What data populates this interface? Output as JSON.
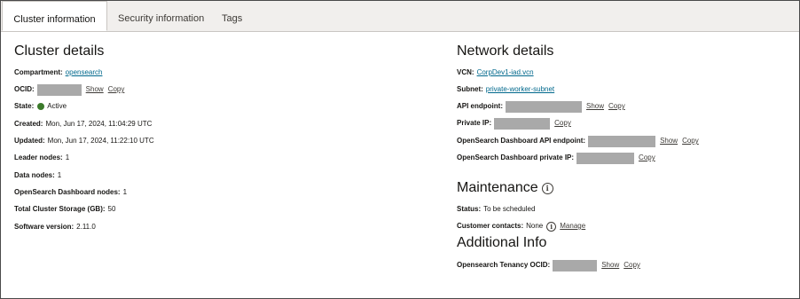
{
  "tabs": [
    {
      "label": "Cluster information",
      "active": true
    },
    {
      "label": "Security information",
      "active": false
    },
    {
      "label": "Tags",
      "active": false
    }
  ],
  "cluster": {
    "title": "Cluster details",
    "compartment": {
      "label": "Compartment:",
      "value": "opensearch"
    },
    "ocid": {
      "label": "OCID:",
      "show": "Show",
      "copy": "Copy"
    },
    "state": {
      "label": "State:",
      "value": "Active",
      "status_color": "#3b7a2a"
    },
    "created": {
      "label": "Created:",
      "value": "Mon, Jun 17, 2024, 11:04:29 UTC"
    },
    "updated": {
      "label": "Updated:",
      "value": "Mon, Jun 17, 2024, 11:22:10 UTC"
    },
    "leader_nodes": {
      "label": "Leader nodes:",
      "value": "1"
    },
    "data_nodes": {
      "label": "Data nodes:",
      "value": "1"
    },
    "dashboard_nodes": {
      "label": "OpenSearch Dashboard nodes:",
      "value": "1"
    },
    "storage": {
      "label": "Total Cluster Storage (GB):",
      "value": "50"
    },
    "software_version": {
      "label": "Software version:",
      "value": "2.11.0"
    }
  },
  "network": {
    "title": "Network details",
    "vcn": {
      "label": "VCN:",
      "value": "CorpDev1-iad.vcn"
    },
    "subnet": {
      "label": "Subnet:",
      "value": "private-worker-subnet"
    },
    "api_endpoint": {
      "label": "API endpoint:",
      "show": "Show",
      "copy": "Copy"
    },
    "private_ip": {
      "label": "Private IP:",
      "copy": "Copy"
    },
    "dashboard_api_endpoint": {
      "label": "OpenSearch Dashboard API endpoint:",
      "show": "Show",
      "copy": "Copy"
    },
    "dashboard_private_ip": {
      "label": "OpenSearch Dashboard private IP:",
      "copy": "Copy"
    }
  },
  "maintenance": {
    "title": "Maintenance",
    "status": {
      "label": "Status:",
      "value": "To be scheduled"
    },
    "customer_contacts": {
      "label": "Customer contacts:",
      "value": "None",
      "manage": "Manage"
    }
  },
  "additional": {
    "title": "Additional Info",
    "tenancy_ocid": {
      "label": "Opensearch Tenancy OCID:",
      "show": "Show",
      "copy": "Copy"
    }
  },
  "icons": {
    "info": "info-icon",
    "status": "status-dot-icon"
  },
  "colors": {
    "link": "#00688c",
    "redacted": "#a9a9a9",
    "active": "#3b7a2a"
  }
}
